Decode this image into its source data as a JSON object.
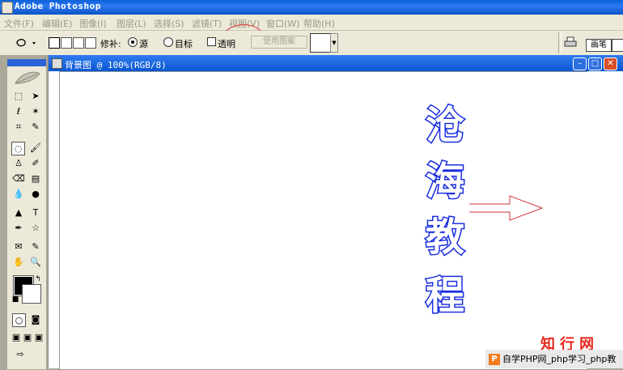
{
  "window": {
    "title": "Adobe Photoshop"
  },
  "menu": [
    {
      "label": "文件(F)"
    },
    {
      "label": "编辑(E)"
    },
    {
      "label": "图像(I)"
    },
    {
      "label": "图层(L)"
    },
    {
      "label": "选择(S)"
    },
    {
      "label": "滤镜(T)"
    },
    {
      "label": "视图(V)"
    },
    {
      "label": "窗口(W)"
    },
    {
      "label": "帮助(H)"
    }
  ],
  "options": {
    "repair_label": "修补:",
    "source_label": "源",
    "target_label": "目标",
    "transparent_label": "透明",
    "use_pattern_label": "使用图案",
    "brushes_tab": "画笔",
    "source_selected": true
  },
  "document": {
    "title": "背景图 @ 100%(RGB/8)",
    "canvas_text": [
      "沧",
      "海",
      "教",
      "程"
    ]
  },
  "colors": {
    "accent": "#1a2ee0",
    "annotation": "#d33333",
    "foreground": "#000000",
    "background": "#ffffff"
  },
  "watermark": {
    "logo": "知行网",
    "caption": "自学PHP网_php学习_php教"
  }
}
